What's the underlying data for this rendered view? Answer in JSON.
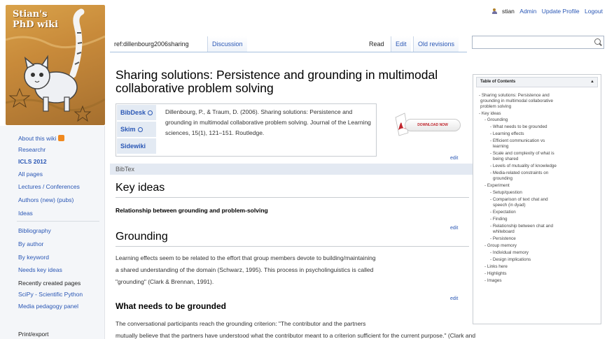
{
  "logo": {
    "text_line1": "Stian's",
    "text_line2": "PhD wiki"
  },
  "userbar": {
    "user": "stian",
    "admin": "Admin",
    "update_profile": "Update Profile",
    "logout": "Logout"
  },
  "tabs": {
    "page": "ref:dillenbourg2006sharing",
    "discussion": "Discussion",
    "read": "Read",
    "edit": "Edit",
    "old_revisions": "Old revisions"
  },
  "search": {
    "placeholder": ""
  },
  "sidebar": {
    "items": [
      "About this wiki",
      "Researchr",
      "ICLS 2012",
      "All pages",
      "Lectures / Conferences",
      "Authors (new) (pubs)",
      "Ideas",
      "Bibliography",
      "By author",
      "By keyword",
      "Needs key ideas",
      "Recently created pages",
      "SciPy - Scientific Python",
      "Media pedagogy panel",
      "Print/export"
    ]
  },
  "page": {
    "title_line1": "Sharing solutions: Persistence and grounding in multimodal",
    "title_line2": "collaborative problem solving",
    "bib_buttons": [
      "BibDesk",
      "Skim",
      "Sidewiki"
    ],
    "citation": "Dillenbourg, P., & Traum, D. (2006). Sharing solutions: Persistence and grounding in multimodal collaborative problem solving. Journal of the Learning sciences, 15(1), 121–151. Routledge.",
    "pdf_label": "DOWNLOAD NOW",
    "edit_label": "edit",
    "bibtex_label": "BibTex",
    "h_key_ideas": "Key ideas",
    "key_relationship": "Relationship between grounding and problem-solving",
    "h_grounding": "Grounding",
    "grounding_p1_line1": "Learning effects seem to be related to the effort that group members devote to building/maintaining",
    "grounding_p1_line2": "a shared understanding of the domain (Schwarz, 1995). This process in psycholinguistics is called",
    "grounding_p1_line3": "\"grounding\" (Clark & Brennan, 1991).",
    "h_what": "What needs to be grounded",
    "what_line1": "The conversational participants reach the grounding criterion: \"The contributor and the partners",
    "what_line2": "mutually believe that the partners have understood what the contributor meant to a criterion sufficient for the current purpose.\" (Clark and"
  },
  "toc": {
    "title": "Table of Contents",
    "toggle": "▲",
    "items": [
      "- Sharing solutions: Persistence and",
      "grounding in multimodal collaborative",
      "problem solving",
      "- Key ideas",
      "- Grounding",
      "- What needs to be grounded",
      "- Learning effects",
      "- Efficient communication vs",
      "learning",
      "- Scale and complexity of what is",
      "being shared",
      "- Levels of mutuality of knowledge",
      "- Media-related constraints on",
      "grounding",
      "- Experiment",
      "- Setup/question",
      "- Comparison of text chat and",
      "speech (in dyad)",
      "- Expectation",
      "- Finding",
      "- Relationship between chat and",
      "whiteboard",
      "- Persistence",
      "- Group memory",
      "- Individual memory",
      "- Design implications",
      "- Links here",
      "- Highlights",
      "- Images"
    ]
  }
}
